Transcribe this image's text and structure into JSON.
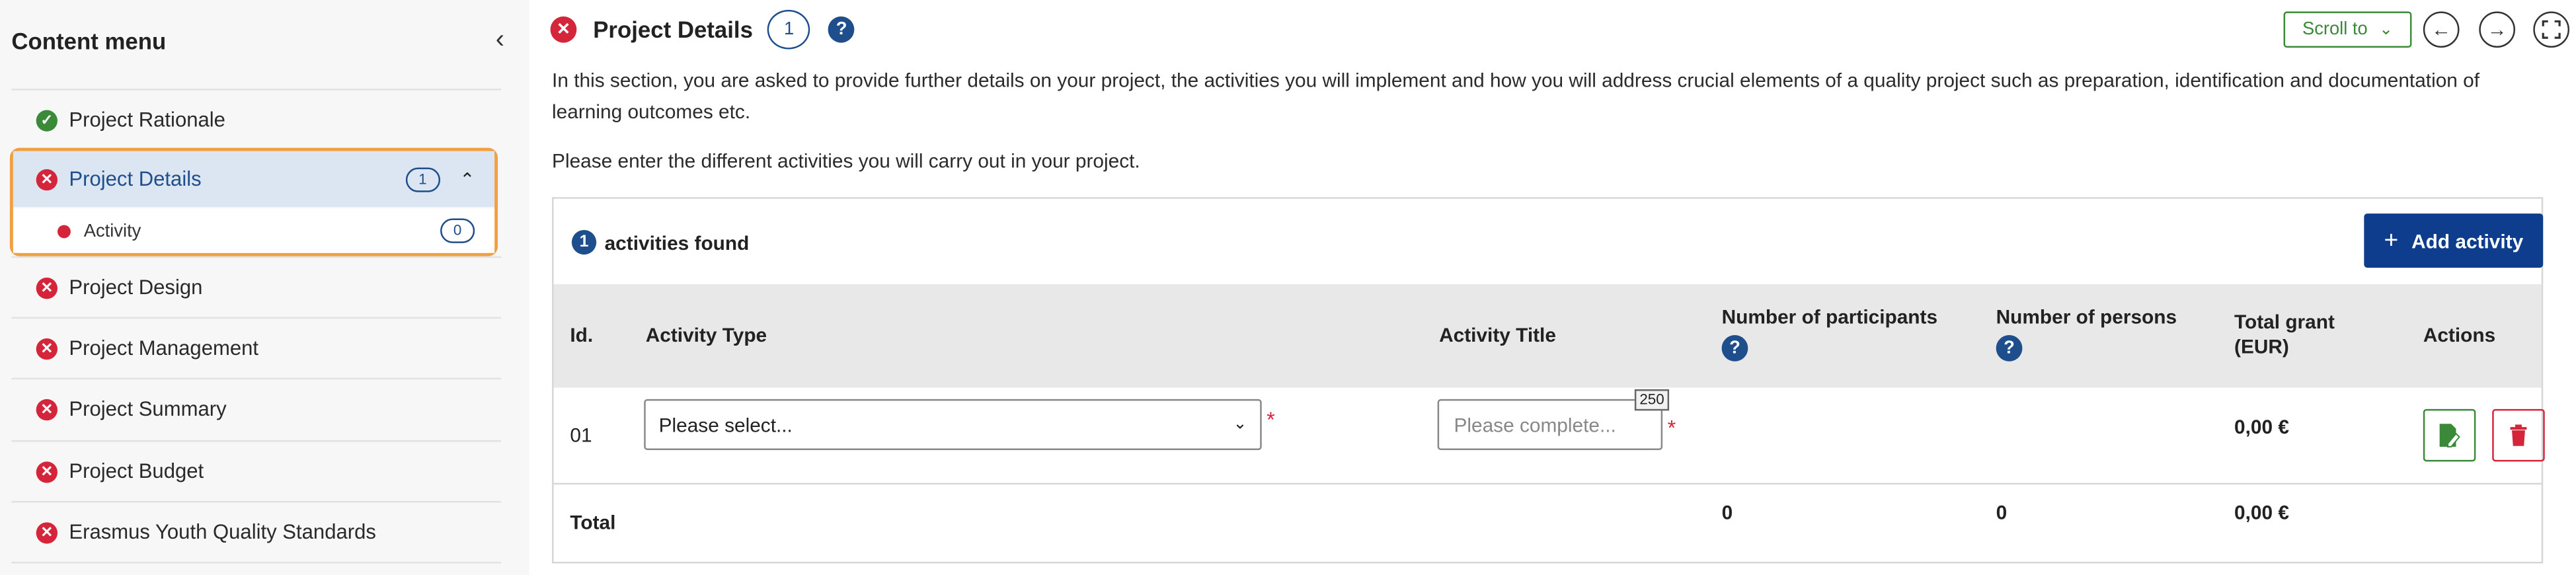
{
  "sidebar": {
    "title": "Content menu",
    "items": [
      {
        "label": "Project Rationale",
        "status": "ok"
      },
      {
        "label": "Project Details",
        "status": "error",
        "count": "1"
      },
      {
        "label": "Project Design",
        "status": "error"
      },
      {
        "label": "Project Management",
        "status": "error"
      },
      {
        "label": "Project Summary",
        "status": "error"
      },
      {
        "label": "Project Budget",
        "status": "error"
      },
      {
        "label": "Erasmus Youth Quality Standards",
        "status": "error"
      }
    ],
    "sub_item": {
      "label": "Activity",
      "count": "0"
    }
  },
  "header": {
    "title": "Project Details",
    "count": "1",
    "scroll_to": "Scroll to"
  },
  "description": {
    "line1": "In this section, you are asked to provide further details on your project, the activities you will implement and how you will address crucial elements of a quality project such as preparation, identification and documentation of",
    "line2": "learning outcomes etc.",
    "line3": "Please enter the different activities you will carry out in your project."
  },
  "panel": {
    "found_count": "1",
    "found_label": "activities found",
    "add_button": "Add activity",
    "columns": {
      "id": "Id.",
      "activity_type": "Activity Type",
      "activity_title": "Activity Title",
      "participants": "Number of participants",
      "persons": "Number of persons",
      "grant_line1": "Total grant",
      "grant_line2": "(EUR)",
      "actions": "Actions"
    },
    "row": {
      "id": "01",
      "select_value": "Please select...",
      "title_placeholder": "Please complete...",
      "char_counter": "250",
      "grant": "0,00 €"
    },
    "total": {
      "label": "Total",
      "participants": "0",
      "persons": "0",
      "grant": "0,00 €"
    }
  },
  "colors": {
    "primary": "#0d3d8c",
    "error": "#d4253a",
    "success": "#3a8a3a",
    "highlight": "#f0a040"
  }
}
